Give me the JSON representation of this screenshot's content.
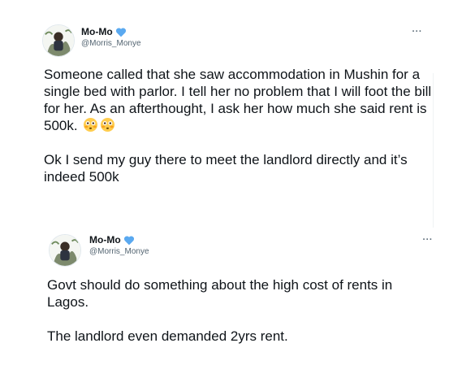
{
  "tweets": [
    {
      "name": "Mo-Mo",
      "handle": "@Morris_Monye",
      "more": "···",
      "paragraphs": [
        "Someone called that she saw accommodation in Mushin for a single bed with parlor. I tell her no problem that I will foot the bill for her. As an afterthought, I ask her how much she said rent is 500k.",
        "Ok I send my guy there to meet the landlord directly and it’s indeed 500k"
      ],
      "emojis": [
        "flushed-face-emoji",
        "flushed-face-emoji"
      ]
    },
    {
      "name": "Mo-Mo",
      "handle": "@Morris_Monye",
      "more": "···",
      "paragraphs": [
        "Govt should do something about the high cost of rents in Lagos.",
        "The landlord even demanded 2yrs rent."
      ]
    }
  ],
  "icons": {
    "verified_heart": "blue-heart-icon",
    "avatar": "profile-photo"
  },
  "colors": {
    "text": "#0f1419",
    "secondary": "#536471",
    "heart": "#5aa9f0"
  }
}
